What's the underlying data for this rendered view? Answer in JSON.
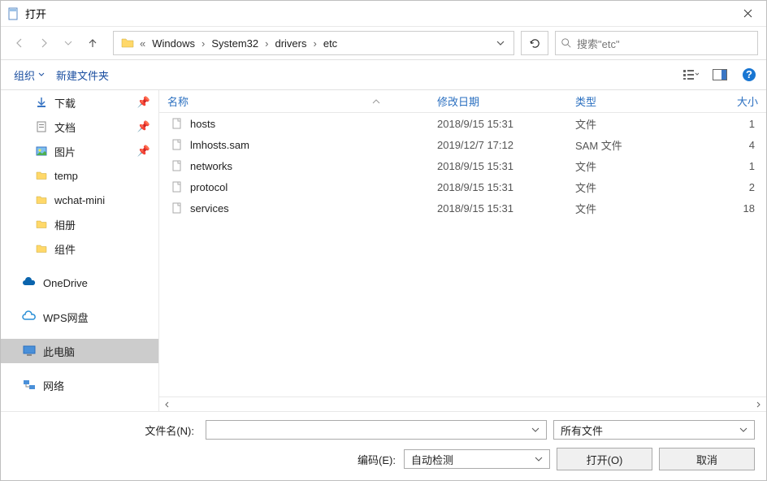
{
  "title": "打开",
  "breadcrumbs": [
    "Windows",
    "System32",
    "drivers",
    "etc"
  ],
  "search_placeholder": "搜索\"etc\"",
  "toolbar": {
    "organize": "组织",
    "newfolder": "新建文件夹"
  },
  "sidebar": {
    "downloads": "下载",
    "documents": "文档",
    "pictures": "图片",
    "temp": "temp",
    "wchat": "wchat-mini",
    "photos": "相册",
    "components": "组件",
    "onedrive": "OneDrive",
    "wps": "WPS网盘",
    "thispc": "此电脑",
    "network": "网络"
  },
  "columns": {
    "name": "名称",
    "date": "修改日期",
    "type": "类型",
    "size": "大小"
  },
  "files": [
    {
      "name": "hosts",
      "date": "2018/9/15 15:31",
      "type": "文件",
      "size": "1"
    },
    {
      "name": "lmhosts.sam",
      "date": "2019/12/7 17:12",
      "type": "SAM 文件",
      "size": "4"
    },
    {
      "name": "networks",
      "date": "2018/9/15 15:31",
      "type": "文件",
      "size": "1"
    },
    {
      "name": "protocol",
      "date": "2018/9/15 15:31",
      "type": "文件",
      "size": "2"
    },
    {
      "name": "services",
      "date": "2018/9/15 15:31",
      "type": "文件",
      "size": "18"
    }
  ],
  "bottom": {
    "filename_label": "文件名(N):",
    "filter": "所有文件",
    "encoding_label": "编码(E):",
    "encoding": "自动检测",
    "open": "打开(O)",
    "cancel": "取消"
  }
}
